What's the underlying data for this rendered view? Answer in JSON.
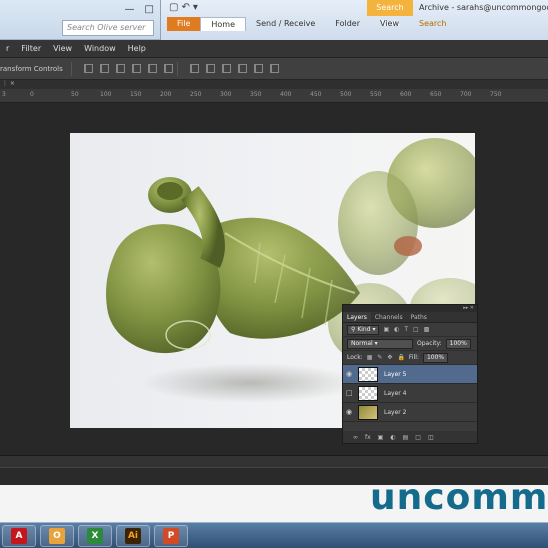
{
  "explorer_bg": {
    "search_placeholder": "Search Olive server"
  },
  "outlook_bg": {
    "search_tools": "Search Tools",
    "title": "Archive - sarahs@uncommongoods.com",
    "tabs": [
      "File",
      "Home",
      "Send / Receive",
      "Folder",
      "View",
      "Search"
    ]
  },
  "ps": {
    "menu": [
      "r",
      "Filter",
      "View",
      "Window",
      "Help"
    ],
    "options_label": "ransform Controls",
    "ruler_ticks": [
      "3",
      "0",
      "50",
      "100",
      "150",
      "200",
      "250",
      "300",
      "350",
      "400",
      "450",
      "500",
      "550",
      "600",
      "650",
      "700",
      "750"
    ]
  },
  "layers_panel": {
    "tabs": [
      "Layers",
      "Channels",
      "Paths"
    ],
    "filter_label": "Kind",
    "blend_mode": "Normal",
    "opacity_label": "Opacity:",
    "opacity_value": "100%",
    "lock_label": "Lock:",
    "fill_label": "Fill:",
    "fill_value": "100%",
    "layers": [
      {
        "name": "Layer 5",
        "visible": true,
        "selected": true
      },
      {
        "name": "Layer 4",
        "visible": false,
        "selected": false
      },
      {
        "name": "Layer 2",
        "visible": true,
        "selected": false
      }
    ]
  },
  "brand_text": "uncommo",
  "taskbar": [
    "A",
    "O",
    "X",
    "Ai",
    "P"
  ],
  "colors": {
    "brand": "#156b8c",
    "selected_layer": "#516a8d",
    "file_tab": "#e07b1f"
  }
}
